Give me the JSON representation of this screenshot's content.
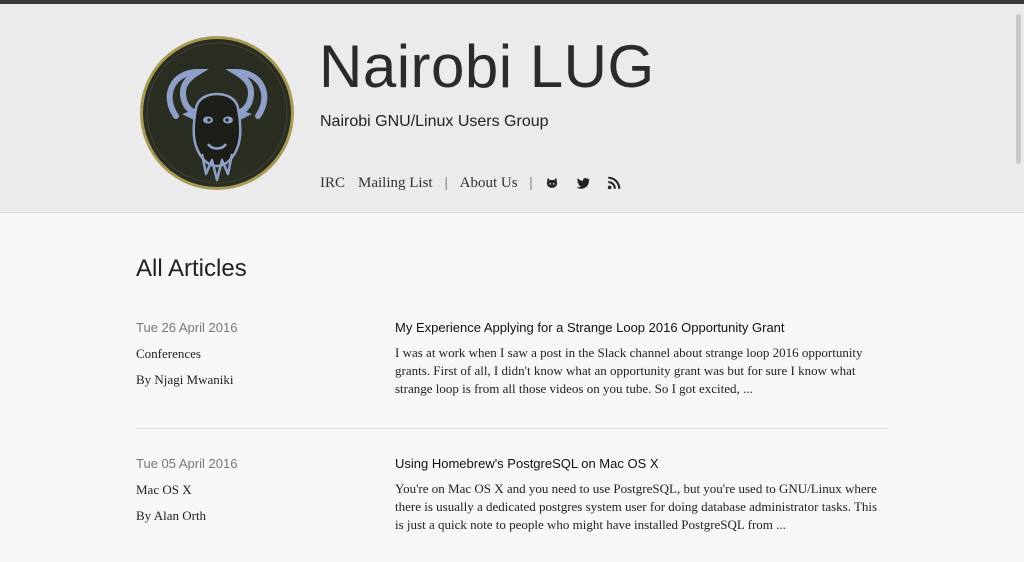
{
  "site": {
    "title": "Nairobi LUG",
    "tagline": "Nairobi GNU/Linux Users Group",
    "logo_text": "GNU/Linux Nairobi LUG"
  },
  "nav": {
    "items": [
      {
        "label": "IRC"
      },
      {
        "label": "Mailing List"
      },
      {
        "label": "About Us"
      }
    ],
    "separator": "|",
    "icons": [
      "github-icon",
      "twitter-icon",
      "rss-icon"
    ]
  },
  "page": {
    "heading": "All Articles"
  },
  "articles": [
    {
      "date": "Tue 26 April 2016",
      "category": "Conferences",
      "author": "By Njagi Mwaniki",
      "title": "My Experience Applying for a Strange Loop 2016 Opportunity Grant",
      "summary": "I was at work when I saw a post in the Slack channel about strange loop 2016 opportunity grants. First of all, I didn't know what an opportunity grant was but for sure I know what strange loop is from all those videos on you tube. So I got excited, ..."
    },
    {
      "date": "Tue 05 April 2016",
      "category": "Mac OS X",
      "author": "By Alan Orth",
      "title": "Using Homebrew's PostgreSQL on Mac OS X",
      "summary": "You're on Mac OS X and you need to use PostgreSQL, but you're used to GNU/Linux where there is usually a dedicated postgres system user for doing database administrator tasks. This is just a quick note to people who might have installed PostgreSQL from ..."
    }
  ],
  "colors": {
    "header_bg": "#ebebeb",
    "page_bg": "#f7f7f7",
    "logo_bg": "#2a2d22",
    "logo_accent": "#8fa0c8",
    "logo_ring": "#a79a55"
  }
}
